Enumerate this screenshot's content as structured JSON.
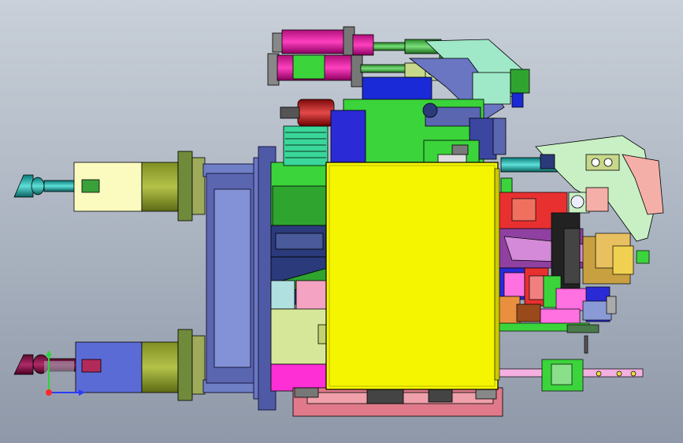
{
  "viewport": {
    "background_top": "#c9d0d9",
    "background_bottom": "#8f98a8"
  },
  "model": {
    "description_icon": "cad-fixture-assembly"
  },
  "triad": {
    "x_axis_color": "#2a3cff",
    "y_axis_color": "#2fd23a",
    "z_axis_color": "#ff2a2a"
  }
}
